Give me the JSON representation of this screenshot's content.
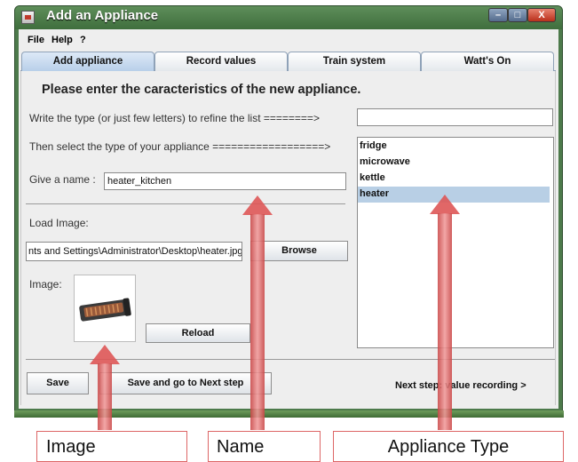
{
  "window": {
    "title": "Add an Appliance",
    "min_glyph": "–",
    "max_glyph": "□",
    "close_glyph": "X"
  },
  "menu": {
    "items": [
      "File",
      "Help",
      "?"
    ]
  },
  "tabs": [
    {
      "label": "Add appliance",
      "active": true
    },
    {
      "label": "Record values",
      "active": false
    },
    {
      "label": "Train system",
      "active": false
    },
    {
      "label": "Watt's On",
      "active": false
    }
  ],
  "form": {
    "heading": "Please enter the caracteristics of the new appliance.",
    "filter_label": "Write the type (or just few letters) to refine the list  ========>",
    "filter_value": "",
    "type_label": "Then select the type of your appliance  ==================>",
    "name_label": "Give a name :",
    "name_value": "heater_kitchen",
    "load_image_label": "Load Image:",
    "image_path_value": "nts and Settings\\Administrator\\Desktop\\heater.jpg",
    "browse_label": "Browse",
    "image_label": "Image:",
    "reload_label": "Reload"
  },
  "appliance_types": {
    "items": [
      "fridge",
      "microwave",
      "kettle",
      "heater"
    ],
    "selected": "heater"
  },
  "footer": {
    "save_label": "Save",
    "save_next_label": "Save and go to Next step",
    "next_step_label": "Next step: value recording  >"
  },
  "annotations": {
    "image_callout": "Image",
    "name_callout": "Name",
    "type_callout": "Appliance Type"
  },
  "colors": {
    "titlebar": "#4d7a4b",
    "selection": "#b8cfe5",
    "active_tab": "#b8cfe9",
    "arrow": "#de5656"
  }
}
